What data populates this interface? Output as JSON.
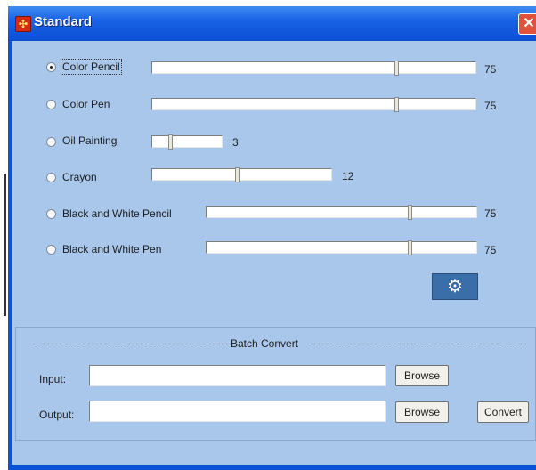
{
  "window": {
    "title": "Standard",
    "close_glyph": "✕"
  },
  "options": [
    {
      "label": "Color Pencil",
      "selected": true,
      "value": "75",
      "level": 0.75
    },
    {
      "label": "Color Pen",
      "selected": false,
      "value": "75",
      "level": 0.75
    },
    {
      "label": "Oil Painting",
      "selected": false,
      "value": "3",
      "level": 0.3
    },
    {
      "label": "Crayon",
      "selected": false,
      "value": "12",
      "level": 0.45
    },
    {
      "label": "Black and White Pencil",
      "selected": false,
      "value": "75",
      "level": 0.75
    },
    {
      "label": "Black and White Pen",
      "selected": false,
      "value": "75",
      "level": 0.75
    }
  ],
  "batch": {
    "title": "Batch Convert",
    "input_label": "Input:",
    "output_label": "Output:",
    "input_value": "",
    "output_value": "",
    "browse_label": "Browse",
    "convert_label": "Convert"
  },
  "icons": {
    "settings": "gear-settings-icon",
    "app": "app-logo-icon"
  },
  "colors": {
    "client_bg": "#a9c7ea",
    "titlebar": "#0a52d6",
    "close": "#e0533a"
  }
}
